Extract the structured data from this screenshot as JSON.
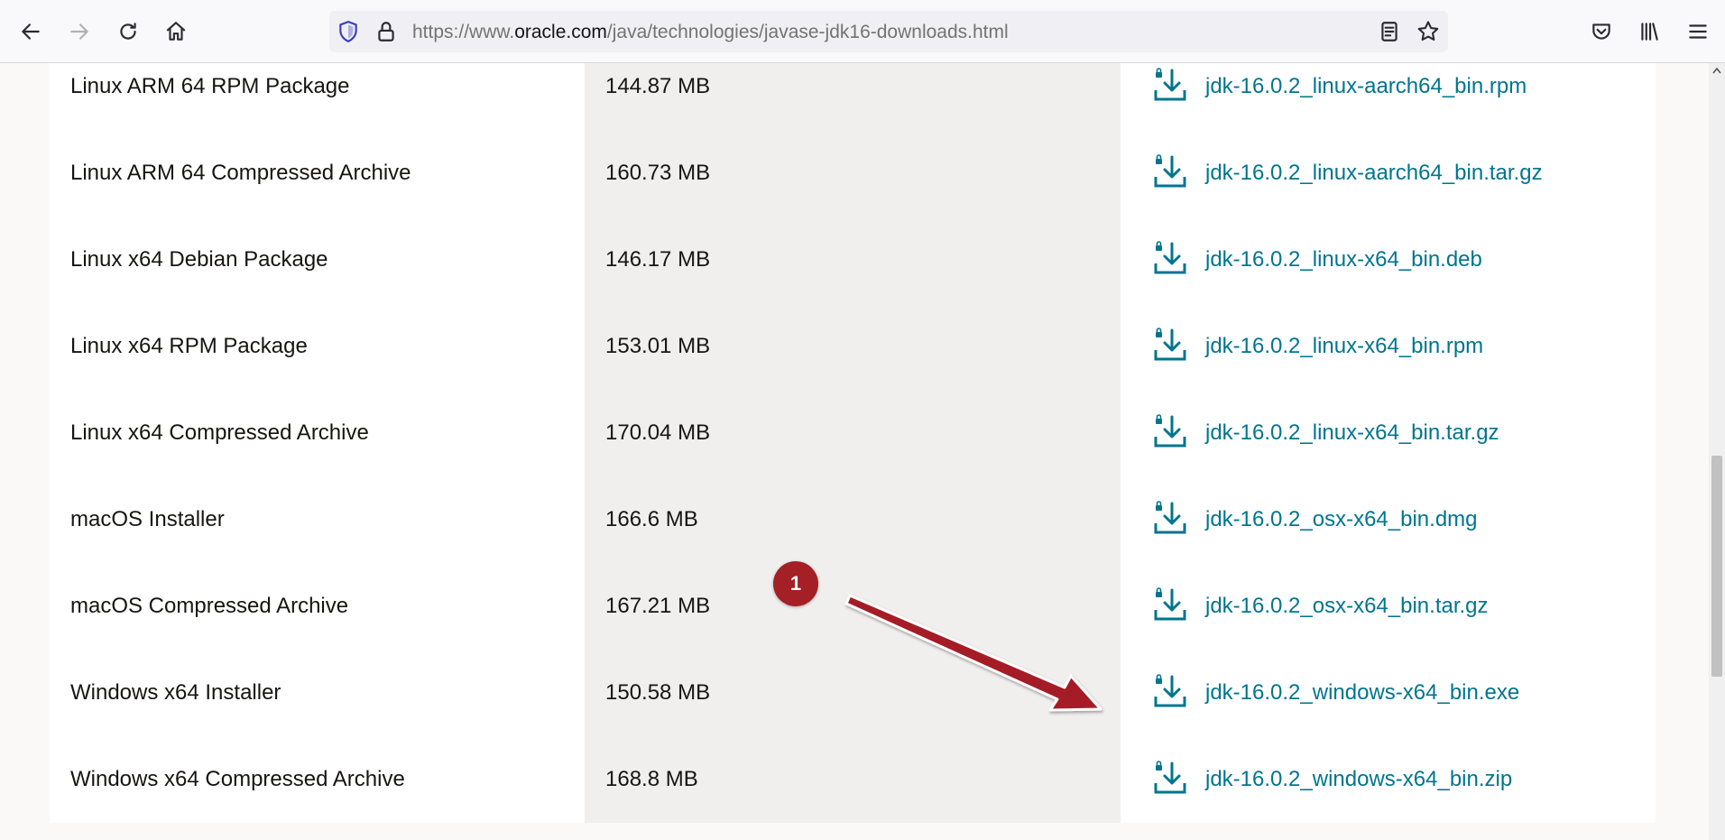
{
  "browser": {
    "url_prefix": "https://www.",
    "url_domain": "oracle.com",
    "url_path": "/java/technologies/javase-jdk16-downloads.html"
  },
  "downloads": [
    {
      "product": "Linux ARM 64 RPM Package",
      "size": "144.87 MB",
      "file": "jdk-16.0.2_linux-aarch64_bin.rpm"
    },
    {
      "product": "Linux ARM 64 Compressed Archive",
      "size": "160.73 MB",
      "file": "jdk-16.0.2_linux-aarch64_bin.tar.gz"
    },
    {
      "product": "Linux x64 Debian Package",
      "size": "146.17 MB",
      "file": "jdk-16.0.2_linux-x64_bin.deb"
    },
    {
      "product": "Linux x64 RPM Package",
      "size": "153.01 MB",
      "file": "jdk-16.0.2_linux-x64_bin.rpm"
    },
    {
      "product": "Linux x64 Compressed Archive",
      "size": "170.04 MB",
      "file": "jdk-16.0.2_linux-x64_bin.tar.gz"
    },
    {
      "product": "macOS Installer",
      "size": "166.6 MB",
      "file": "jdk-16.0.2_osx-x64_bin.dmg"
    },
    {
      "product": "macOS Compressed Archive",
      "size": "167.21 MB",
      "file": "jdk-16.0.2_osx-x64_bin.tar.gz"
    },
    {
      "product": "Windows x64 Installer",
      "size": "150.58 MB",
      "file": "jdk-16.0.2_windows-x64_bin.exe"
    },
    {
      "product": "Windows x64 Compressed Archive",
      "size": "168.8 MB",
      "file": "jdk-16.0.2_windows-x64_bin.zip"
    }
  ],
  "annotation": {
    "badge_number": "1"
  },
  "colors": {
    "link": "#00758f",
    "annotation": "#a51f26",
    "size_column_bg": "#f1efed"
  }
}
